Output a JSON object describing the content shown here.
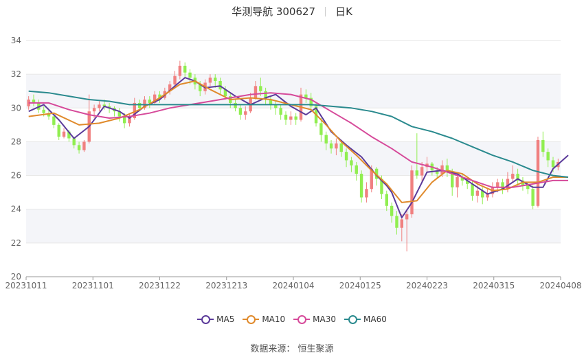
{
  "title": {
    "name": "华测导航 300627",
    "period": "日K"
  },
  "source_text": "数据来源： 恒生聚源",
  "chart_data": {
    "type": "candlestick",
    "y_ticks": [
      20,
      22,
      24,
      26,
      28,
      30,
      32,
      34
    ],
    "ylim": [
      20,
      34
    ],
    "x_tick_labels": [
      "20231011",
      "20231101",
      "20231122",
      "20231213",
      "20240104",
      "20240125",
      "20240223",
      "20240315",
      "20240408"
    ],
    "grid": true,
    "legend_position": "bottom",
    "up_color": "#f08080",
    "down_color": "#90ee50",
    "candles": [
      [
        30.1,
        30.5,
        30.7,
        29.9
      ],
      [
        30.5,
        30.3,
        30.8,
        30.1
      ],
      [
        30.3,
        29.9,
        30.5,
        29.7
      ],
      [
        29.9,
        29.7,
        30.1,
        29.5
      ],
      [
        29.7,
        29.5,
        29.9,
        29.3
      ],
      [
        29.5,
        29.0,
        29.7,
        28.8
      ],
      [
        29.0,
        28.3,
        29.1,
        28.1
      ],
      [
        28.3,
        28.6,
        28.8,
        28.2
      ],
      [
        28.6,
        28.2,
        28.7,
        28.0
      ],
      [
        28.2,
        27.8,
        28.3,
        27.6
      ],
      [
        27.8,
        27.5,
        28.0,
        27.3
      ],
      [
        27.5,
        28.0,
        28.1,
        27.4
      ],
      [
        28.0,
        29.8,
        30.8,
        27.9
      ],
      [
        29.8,
        30.0,
        30.2,
        29.4
      ],
      [
        30.0,
        30.2,
        30.4,
        29.8
      ],
      [
        30.2,
        30.1,
        30.5,
        29.9
      ],
      [
        30.1,
        30.0,
        30.3,
        29.7
      ],
      [
        30.0,
        29.8,
        30.1,
        29.5
      ],
      [
        29.8,
        29.5,
        30.0,
        29.2
      ],
      [
        29.5,
        29.1,
        29.7,
        28.8
      ],
      [
        29.1,
        29.4,
        29.6,
        28.9
      ],
      [
        29.4,
        30.3,
        30.6,
        29.3
      ],
      [
        30.3,
        30.0,
        30.5,
        29.8
      ],
      [
        30.0,
        30.5,
        30.7,
        29.9
      ],
      [
        30.5,
        30.3,
        30.7,
        30.0
      ],
      [
        30.3,
        30.8,
        31.0,
        30.2
      ],
      [
        30.8,
        30.6,
        31.0,
        30.3
      ],
      [
        30.6,
        31.0,
        31.2,
        30.5
      ],
      [
        31.0,
        31.4,
        31.6,
        30.8
      ],
      [
        31.4,
        31.9,
        32.2,
        31.2
      ],
      [
        31.9,
        32.5,
        32.8,
        31.7
      ],
      [
        32.5,
        32.1,
        32.7,
        31.8
      ],
      [
        32.1,
        31.8,
        32.3,
        31.4
      ],
      [
        31.8,
        31.4,
        32.0,
        31.1
      ],
      [
        31.4,
        31.0,
        31.6,
        30.7
      ],
      [
        31.0,
        31.5,
        31.7,
        30.8
      ],
      [
        31.5,
        31.8,
        32.0,
        31.3
      ],
      [
        31.8,
        31.6,
        32.0,
        31.2
      ],
      [
        31.6,
        31.1,
        31.8,
        30.8
      ],
      [
        31.1,
        30.7,
        31.3,
        30.5
      ],
      [
        30.7,
        30.3,
        30.9,
        30.0
      ],
      [
        30.3,
        30.0,
        30.5,
        29.8
      ],
      [
        30.0,
        29.6,
        30.2,
        29.3
      ],
      [
        29.6,
        29.8,
        30.1,
        29.3
      ],
      [
        29.8,
        30.6,
        30.9,
        29.7
      ],
      [
        30.6,
        31.3,
        31.6,
        30.5
      ],
      [
        31.3,
        31.0,
        31.8,
        30.7
      ],
      [
        31.0,
        30.5,
        31.2,
        30.2
      ],
      [
        30.5,
        30.2,
        30.7,
        29.9
      ],
      [
        30.2,
        30.0,
        30.4,
        29.6
      ],
      [
        30.0,
        29.6,
        30.2,
        29.3
      ],
      [
        29.6,
        29.3,
        29.8,
        29.0
      ],
      [
        29.3,
        29.5,
        29.8,
        29.0
      ],
      [
        29.5,
        29.3,
        29.7,
        29.0
      ],
      [
        29.3,
        30.8,
        31.2,
        29.2
      ],
      [
        30.8,
        30.6,
        31.1,
        30.3
      ],
      [
        30.6,
        30.1,
        30.9,
        29.8
      ],
      [
        30.1,
        29.1,
        30.3,
        28.9
      ],
      [
        29.1,
        28.4,
        29.4,
        28.0
      ],
      [
        28.4,
        27.9,
        28.6,
        27.5
      ],
      [
        27.9,
        27.6,
        28.1,
        27.3
      ],
      [
        27.6,
        27.9,
        28.2,
        27.2
      ],
      [
        27.9,
        27.4,
        28.1,
        27.1
      ],
      [
        27.4,
        26.9,
        27.6,
        26.5
      ],
      [
        26.9,
        26.6,
        27.1,
        26.2
      ],
      [
        26.6,
        26.1,
        26.8,
        25.7
      ],
      [
        26.1,
        24.7,
        26.3,
        24.4
      ],
      [
        24.7,
        25.2,
        25.6,
        24.4
      ],
      [
        25.2,
        26.4,
        26.6,
        25.0
      ],
      [
        26.4,
        25.8,
        26.5,
        25.4
      ],
      [
        25.8,
        24.9,
        26.0,
        24.6
      ],
      [
        24.9,
        24.2,
        25.1,
        23.9
      ],
      [
        24.2,
        23.6,
        24.4,
        23.2
      ],
      [
        23.6,
        22.9,
        23.9,
        22.5
      ],
      [
        22.9,
        23.4,
        23.7,
        22.1
      ],
      [
        23.4,
        23.7,
        24.0,
        21.5
      ],
      [
        23.7,
        26.3,
        26.6,
        23.5
      ],
      [
        26.3,
        26.0,
        28.5,
        25.8
      ],
      [
        26.0,
        26.5,
        26.8,
        25.6
      ],
      [
        26.5,
        26.7,
        27.1,
        26.2
      ],
      [
        26.7,
        26.3,
        26.8,
        26.0
      ],
      [
        26.3,
        26.1,
        26.5,
        25.8
      ],
      [
        26.1,
        26.6,
        26.9,
        25.9
      ],
      [
        26.6,
        26.2,
        27.0,
        25.9
      ],
      [
        26.2,
        25.3,
        26.4,
        24.8
      ],
      [
        25.3,
        25.9,
        26.2,
        24.7
      ],
      [
        25.9,
        25.7,
        26.1,
        25.4
      ],
      [
        25.7,
        25.5,
        25.9,
        25.2
      ],
      [
        25.5,
        24.8,
        25.7,
        24.5
      ],
      [
        24.8,
        25.1,
        25.4,
        24.4
      ],
      [
        25.1,
        24.7,
        25.3,
        24.3
      ],
      [
        24.7,
        24.9,
        25.2,
        24.5
      ],
      [
        24.9,
        25.3,
        25.6,
        24.7
      ],
      [
        25.3,
        25.6,
        25.8,
        25.0
      ],
      [
        25.6,
        25.2,
        25.8,
        24.9
      ],
      [
        25.2,
        25.8,
        26.2,
        25.0
      ],
      [
        25.8,
        26.1,
        26.6,
        25.6
      ],
      [
        26.1,
        25.7,
        26.4,
        25.4
      ],
      [
        25.7,
        25.4,
        25.9,
        25.1
      ],
      [
        25.4,
        25.2,
        25.6,
        24.9
      ],
      [
        25.2,
        24.2,
        25.4,
        24.0
      ],
      [
        24.2,
        28.1,
        28.3,
        24.1
      ],
      [
        28.1,
        27.4,
        28.6,
        27.1
      ],
      [
        27.4,
        26.9,
        27.6,
        26.5
      ],
      [
        26.9,
        26.5,
        27.1,
        26.2
      ],
      [
        26.5,
        26.8,
        27.0,
        26.3
      ]
    ],
    "series": [
      {
        "name": "MA5",
        "color": "#5b3a9a",
        "values": [
          [
            0,
            29.8
          ],
          [
            3,
            30.2
          ],
          [
            6,
            29.3
          ],
          [
            9,
            28.2
          ],
          [
            12,
            28.9
          ],
          [
            15,
            30.1
          ],
          [
            18,
            29.8
          ],
          [
            20,
            29.4
          ],
          [
            23,
            30.1
          ],
          [
            26,
            30.5
          ],
          [
            29,
            31.3
          ],
          [
            31,
            31.8
          ],
          [
            33,
            31.6
          ],
          [
            35,
            31.2
          ],
          [
            38,
            31.3
          ],
          [
            41,
            30.7
          ],
          [
            44,
            30.2
          ],
          [
            47,
            30.6
          ],
          [
            49,
            30.8
          ],
          [
            52,
            30.1
          ],
          [
            55,
            29.6
          ],
          [
            57,
            30.0
          ],
          [
            60,
            28.6
          ],
          [
            63,
            27.8
          ],
          [
            66,
            27.1
          ],
          [
            69,
            26.0
          ],
          [
            71,
            25.4
          ],
          [
            72,
            25.0
          ],
          [
            74,
            23.5
          ],
          [
            76,
            24.4
          ],
          [
            79,
            26.2
          ],
          [
            82,
            26.3
          ],
          [
            85,
            26.1
          ],
          [
            88,
            25.5
          ],
          [
            91,
            24.9
          ],
          [
            94,
            25.2
          ],
          [
            97,
            25.8
          ],
          [
            100,
            25.3
          ],
          [
            102,
            25.3
          ],
          [
            104,
            26.4
          ],
          [
            107,
            27.2
          ]
        ]
      },
      {
        "name": "MA10",
        "color": "#e08a2c",
        "values": [
          [
            0,
            29.5
          ],
          [
            5,
            29.7
          ],
          [
            10,
            29.0
          ],
          [
            14,
            29.1
          ],
          [
            18,
            29.4
          ],
          [
            22,
            29.9
          ],
          [
            26,
            30.6
          ],
          [
            30,
            31.4
          ],
          [
            33,
            31.6
          ],
          [
            36,
            31.1
          ],
          [
            40,
            30.5
          ],
          [
            44,
            30.6
          ],
          [
            48,
            30.5
          ],
          [
            52,
            30.2
          ],
          [
            56,
            29.9
          ],
          [
            59,
            29.0
          ],
          [
            62,
            28.0
          ],
          [
            65,
            27.2
          ],
          [
            68,
            26.3
          ],
          [
            71,
            25.5
          ],
          [
            74,
            24.4
          ],
          [
            77,
            24.5
          ],
          [
            80,
            25.6
          ],
          [
            83,
            26.3
          ],
          [
            86,
            26.1
          ],
          [
            89,
            25.5
          ],
          [
            92,
            25.1
          ],
          [
            95,
            25.2
          ],
          [
            98,
            25.6
          ],
          [
            101,
            25.6
          ],
          [
            104,
            25.9
          ],
          [
            107,
            25.9
          ]
        ]
      },
      {
        "name": "MA30",
        "color": "#d64a9a",
        "values": [
          [
            0,
            30.3
          ],
          [
            4,
            30.3
          ],
          [
            8,
            29.9
          ],
          [
            12,
            29.6
          ],
          [
            16,
            29.4
          ],
          [
            20,
            29.5
          ],
          [
            24,
            29.7
          ],
          [
            28,
            30.0
          ],
          [
            32,
            30.2
          ],
          [
            36,
            30.4
          ],
          [
            40,
            30.6
          ],
          [
            44,
            30.8
          ],
          [
            48,
            30.9
          ],
          [
            52,
            30.8
          ],
          [
            56,
            30.5
          ],
          [
            60,
            29.8
          ],
          [
            64,
            29.1
          ],
          [
            68,
            28.3
          ],
          [
            72,
            27.6
          ],
          [
            76,
            26.8
          ],
          [
            80,
            26.5
          ],
          [
            84,
            26.1
          ],
          [
            88,
            25.7
          ],
          [
            92,
            25.3
          ],
          [
            96,
            25.3
          ],
          [
            100,
            25.5
          ],
          [
            104,
            25.7
          ],
          [
            107,
            25.7
          ]
        ]
      },
      {
        "name": "MA60",
        "color": "#2a8a8e",
        "values": [
          [
            0,
            31.0
          ],
          [
            4,
            30.9
          ],
          [
            8,
            30.7
          ],
          [
            12,
            30.5
          ],
          [
            16,
            30.4
          ],
          [
            20,
            30.2
          ],
          [
            24,
            30.2
          ],
          [
            28,
            30.2
          ],
          [
            32,
            30.2
          ],
          [
            36,
            30.2
          ],
          [
            40,
            30.2
          ],
          [
            44,
            30.2
          ],
          [
            48,
            30.2
          ],
          [
            52,
            30.2
          ],
          [
            56,
            30.2
          ],
          [
            60,
            30.1
          ],
          [
            64,
            30.0
          ],
          [
            68,
            29.8
          ],
          [
            72,
            29.5
          ],
          [
            76,
            28.9
          ],
          [
            80,
            28.6
          ],
          [
            84,
            28.2
          ],
          [
            88,
            27.7
          ],
          [
            92,
            27.2
          ],
          [
            96,
            26.8
          ],
          [
            100,
            26.3
          ],
          [
            104,
            26.0
          ],
          [
            107,
            25.9
          ]
        ]
      }
    ]
  }
}
